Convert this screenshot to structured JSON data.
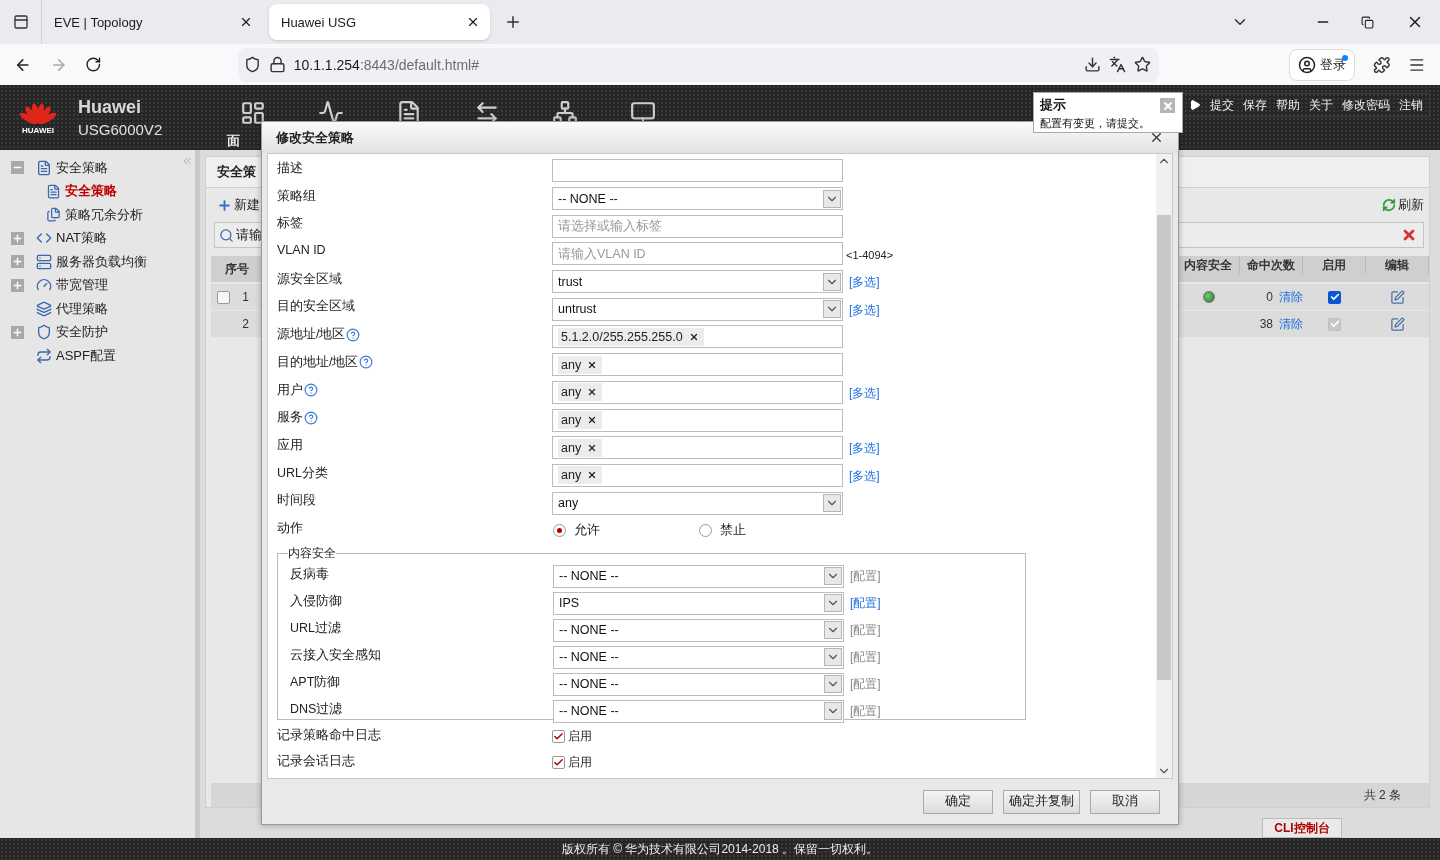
{
  "browser": {
    "tabs": [
      {
        "title": "EVE | Topology",
        "selected": false
      },
      {
        "title": "Huawei USG",
        "selected": true
      }
    ],
    "url_host": "10.1.1.254",
    "url_rest": ":8443/default.html#",
    "sign_in": "登录"
  },
  "header": {
    "logo_text": "HUAWEI",
    "brand": "Huawei",
    "model": "USG6000V2",
    "nav_label": "面",
    "links": [
      "提交",
      "保存",
      "帮助",
      "关于",
      "修改密码",
      "注销"
    ]
  },
  "notice": {
    "title": "提示",
    "message": "配置有变更，请提交。"
  },
  "sidebar": {
    "items": [
      {
        "label": "安全策略",
        "kind": "group",
        "expanded": true,
        "selected": false,
        "children": [
          {
            "label": "安全策略",
            "selected": true
          },
          {
            "label": "策略冗余分析",
            "selected": false
          }
        ]
      },
      {
        "label": "NAT策略",
        "kind": "group",
        "expanded": false,
        "selected": false
      },
      {
        "label": "服务器负载均衡",
        "kind": "group",
        "expanded": false,
        "selected": false
      },
      {
        "label": "带宽管理",
        "kind": "group",
        "expanded": false,
        "selected": false
      },
      {
        "label": "代理策略",
        "kind": "leaf",
        "selected": false
      },
      {
        "label": "安全防护",
        "kind": "group",
        "expanded": false,
        "selected": false
      },
      {
        "label": "ASPF配置",
        "kind": "leaf",
        "selected": false
      }
    ]
  },
  "policy_panel": {
    "title": "安全策",
    "new_label": "新建",
    "refresh": "刷新",
    "search_placeholder": "请输",
    "column_left": "序号",
    "columns_right": [
      "内容安全",
      "命中次数",
      "启用",
      "编辑"
    ],
    "rows": [
      {
        "kind": "policy",
        "checked": false,
        "index": "1",
        "security_on": true,
        "hits": "0",
        "clear": "清除",
        "enabled": {
          "checked": true,
          "disabled": false
        }
      },
      {
        "kind": "default",
        "index": "2",
        "security_on": false,
        "hits": "38",
        "clear": "清除",
        "enabled": {
          "checked": true,
          "disabled": true
        }
      }
    ],
    "total": "共 2 条"
  },
  "dialog": {
    "title": "修改安全策略",
    "fields": [
      {
        "kind": "input",
        "label": "描述",
        "help": false
      },
      {
        "kind": "select",
        "label": "策略组",
        "value": "-- NONE --",
        "help": false
      },
      {
        "kind": "input",
        "label": "标签",
        "placeholder": "请选择或输入标签",
        "help": false
      },
      {
        "kind": "input",
        "label": "VLAN ID",
        "placeholder": "请输入VLAN ID",
        "hint": "<1-4094>",
        "help": false
      },
      {
        "kind": "select",
        "label": "源安全区域",
        "value": "trust",
        "link": "[多选]",
        "help": false
      },
      {
        "kind": "select",
        "label": "目的安全区域",
        "value": "untrust",
        "link": "[多选]",
        "help": false
      },
      {
        "kind": "tags",
        "label": "源地址/地区",
        "tags": [
          "5.1.2.0/255.255.255.0"
        ],
        "help": true
      },
      {
        "kind": "tags",
        "label": "目的地址/地区",
        "tags": [
          "any"
        ],
        "help": true
      },
      {
        "kind": "tags",
        "label": "用户",
        "tags": [
          "any"
        ],
        "link": "[多选]",
        "help": true
      },
      {
        "kind": "tags",
        "label": "服务",
        "tags": [
          "any"
        ],
        "help": true
      },
      {
        "kind": "tags",
        "label": "应用",
        "tags": [
          "any"
        ],
        "link": "[多选]",
        "help": false
      },
      {
        "kind": "tags",
        "label": "URL分类",
        "tags": [
          "any"
        ],
        "link": "[多选]",
        "help": false
      },
      {
        "kind": "select",
        "label": "时间段",
        "value": "any",
        "help": false
      },
      {
        "kind": "radio",
        "label": "动作",
        "help": false,
        "options": [
          {
            "label": "允许",
            "selected": true
          },
          {
            "label": "禁止",
            "selected": false
          }
        ]
      }
    ],
    "content_security": {
      "legend": "内容安全",
      "rows": [
        {
          "label": "反病毒",
          "value": "-- NONE --",
          "link": "[配置]",
          "link_enabled": false
        },
        {
          "label": "入侵防御",
          "value": "IPS",
          "link": "[配置]",
          "link_enabled": true
        },
        {
          "label": "URL过滤",
          "value": "-- NONE --",
          "link": "[配置]",
          "link_enabled": false
        },
        {
          "label": "云接入安全感知",
          "value": "-- NONE --",
          "link": "[配置]",
          "link_enabled": false
        },
        {
          "label": "APT防御",
          "value": "-- NONE --",
          "link": "[配置]",
          "link_enabled": false
        },
        {
          "label": "DNS过滤",
          "value": "-- NONE --",
          "link": "[配置]",
          "link_enabled": false
        }
      ]
    },
    "logs": [
      {
        "label": "记录策略命中日志",
        "checked": true,
        "option": "启用"
      },
      {
        "label": "记录会话日志",
        "checked": true,
        "option": "启用"
      }
    ],
    "buttons": [
      "确定",
      "确定并复制",
      "取消"
    ]
  },
  "footer": {
    "copyright": "版权所有 © 华为技术有限公司2014-2018 。保留一切权利。",
    "cli": "CLI控制台"
  }
}
